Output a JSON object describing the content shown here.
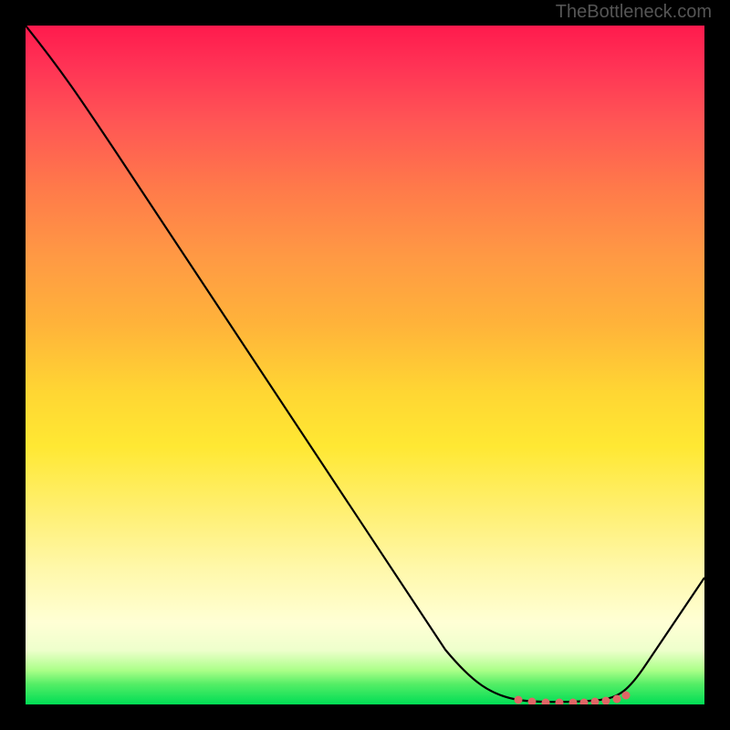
{
  "watermark": "TheBottleneck.com",
  "chart_data": {
    "type": "line",
    "title": "",
    "xlabel": "",
    "ylabel": "",
    "x": [
      0,
      5,
      10,
      15,
      20,
      25,
      30,
      35,
      40,
      45,
      50,
      55,
      60,
      65,
      68,
      70,
      73,
      76,
      79,
      82,
      85,
      88,
      92,
      96,
      100
    ],
    "y": [
      100,
      94,
      87,
      79,
      71,
      63,
      55,
      47,
      39,
      31,
      24,
      17,
      11,
      6,
      3,
      1.5,
      0.5,
      0,
      0,
      0,
      0,
      1,
      4,
      10,
      18
    ],
    "xlim": [
      0,
      100
    ],
    "ylim": [
      0,
      100
    ],
    "markers": {
      "x": [
        73,
        75,
        77,
        79,
        80.5,
        82,
        83.5,
        85,
        86.5,
        88
      ],
      "y": [
        0.5,
        0.2,
        0,
        0,
        0,
        0,
        0,
        0,
        0.3,
        1
      ],
      "color": "#e06666"
    },
    "curve_color": "#000000",
    "marker_color": "#e06666",
    "background_gradient": {
      "top": "#ff1a4d",
      "bottom": "#00dd55"
    }
  }
}
